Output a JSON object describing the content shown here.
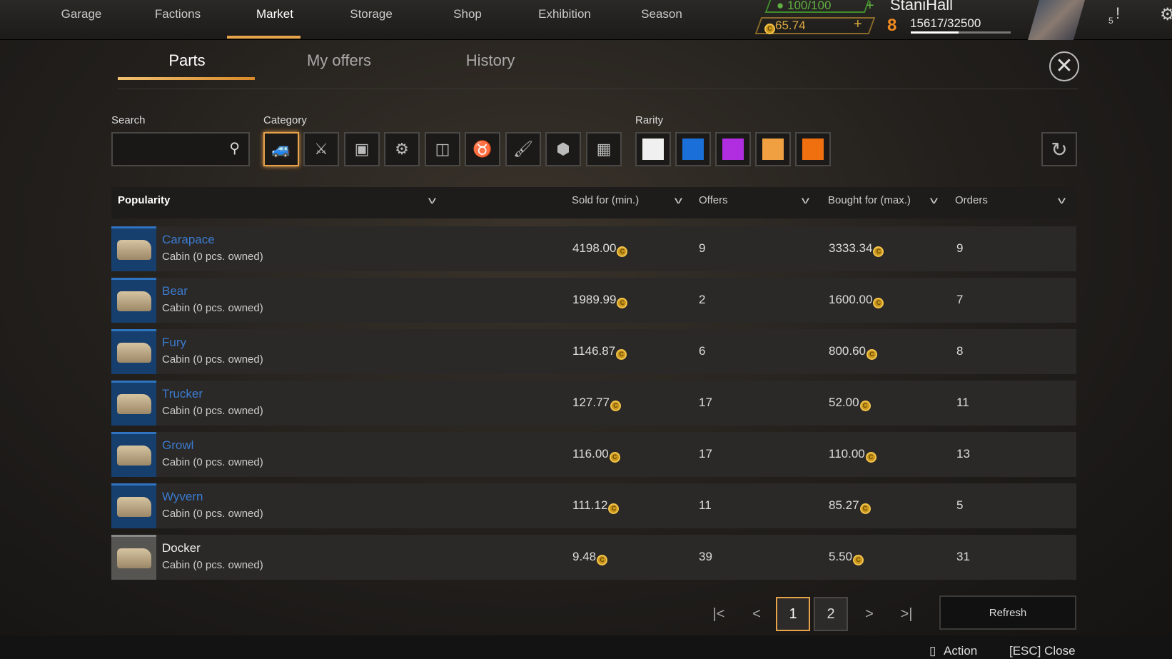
{
  "nav": {
    "tabs": [
      "Garage",
      "Factions",
      "Market",
      "Storage",
      "Shop",
      "Exhibition",
      "Season"
    ],
    "active": "Market"
  },
  "status": {
    "fuel": "100/100",
    "coins": "65.74",
    "player_name": "StaniHall",
    "level": "8",
    "xp": "15617/32500",
    "xp_progress": 0.48,
    "notifications": "5"
  },
  "subtabs": [
    "Parts",
    "My offers",
    "History"
  ],
  "filters": {
    "search_label": "Search",
    "search_value": "",
    "category_label": "Category",
    "categories": [
      "cabin-icon",
      "weapon-icon",
      "module-icon",
      "wheel-icon",
      "frame-icon",
      "decor-icon",
      "paint-icon",
      "hardware-icon",
      "grid-icon"
    ],
    "rarity_label": "Rarity",
    "rarities": [
      "#f0f0f0",
      "#1a6fd8",
      "#b12ee0",
      "#f0a040",
      "#f07010"
    ]
  },
  "columns": {
    "sort": "Popularity",
    "sold": "Sold for (min.)",
    "offers": "Offers",
    "bought": "Bought for (max.)",
    "orders": "Orders"
  },
  "rows": [
    {
      "name": "Carapace",
      "sub": "Cabin (0 pcs. owned)",
      "sold": "4198.00",
      "offers": "9",
      "bought": "3333.34",
      "orders": "9",
      "rarity": "rare"
    },
    {
      "name": "Bear",
      "sub": "Cabin (0 pcs. owned)",
      "sold": "1989.99",
      "offers": "2",
      "bought": "1600.00",
      "orders": "7",
      "rarity": "rare"
    },
    {
      "name": "Fury",
      "sub": "Cabin (0 pcs. owned)",
      "sold": "1146.87",
      "offers": "6",
      "bought": "800.60",
      "orders": "8",
      "rarity": "rare"
    },
    {
      "name": "Trucker",
      "sub": "Cabin (0 pcs. owned)",
      "sold": "127.77",
      "offers": "17",
      "bought": "52.00",
      "orders": "11",
      "rarity": "rare"
    },
    {
      "name": "Growl",
      "sub": "Cabin (0 pcs. owned)",
      "sold": "116.00",
      "offers": "17",
      "bought": "110.00",
      "orders": "13",
      "rarity": "rare"
    },
    {
      "name": "Wyvern",
      "sub": "Cabin (0 pcs. owned)",
      "sold": "111.12",
      "offers": "11",
      "bought": "85.27",
      "orders": "5",
      "rarity": "rare"
    },
    {
      "name": "Docker",
      "sub": "Cabin (0 pcs. owned)",
      "sold": "9.48",
      "offers": "39",
      "bought": "5.50",
      "orders": "31",
      "rarity": "common"
    }
  ],
  "pagination": {
    "pages": [
      "1",
      "2"
    ],
    "current": "1",
    "refresh": "Refresh"
  },
  "footer": {
    "action": "Action",
    "close": "[ESC] Close"
  }
}
